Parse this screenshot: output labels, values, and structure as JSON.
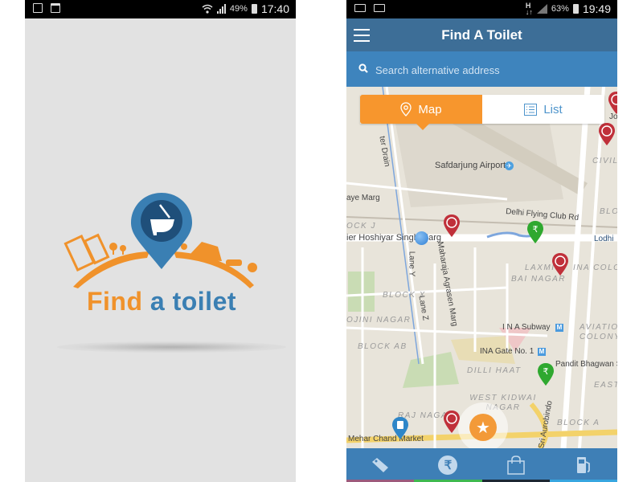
{
  "splash": {
    "status": {
      "battery": "49%",
      "time": "17:40",
      "left_icons": [
        "gallery-icon",
        "clipboard-check-icon"
      ],
      "right_icons": [
        "wifi-icon",
        "signal-icon",
        "battery-icon"
      ]
    },
    "logo": {
      "word1": "Find",
      "word2": "a toilet",
      "colors": {
        "orange": "#f0922b",
        "blue": "#3a7fb3",
        "dark_blue": "#1f4f7a"
      }
    }
  },
  "app": {
    "status": {
      "battery": "63%",
      "time": "19:49",
      "left_icons": [
        "settings-mail-icon",
        "mail-icon"
      ],
      "right_icons": [
        "h-plus-data-icon",
        "signal-icon",
        "battery-icon"
      ]
    },
    "appbar": {
      "title": "Find A Toilet",
      "menu_icon": "hamburger-icon",
      "color": "#3d6e97"
    },
    "search": {
      "placeholder": "Search alternative address",
      "value": "",
      "icon": "search-icon",
      "color": "#3e84bd"
    },
    "toggle": {
      "map_label": "Map",
      "list_label": "List",
      "active": "Map",
      "active_color": "#f7962d"
    },
    "map": {
      "labels": [
        {
          "text": "Safdarjung Airport",
          "type": "poi"
        },
        {
          "text": "Delhi Flying Club Rd",
          "type": "road"
        },
        {
          "text": "aye Marg",
          "type": "road"
        },
        {
          "text": "ier Hoshiyar Singh Marg",
          "type": "road"
        },
        {
          "text": "Lodhi",
          "type": "road"
        },
        {
          "text": "Lane Y",
          "type": "road"
        },
        {
          "text": "Lane Z",
          "type": "road"
        },
        {
          "text": "Maharaja Agrasen Marg",
          "type": "road"
        },
        {
          "text": "ter Drain",
          "type": "road"
        },
        {
          "text": "OCK J",
          "type": "area"
        },
        {
          "text": "LAXMI",
          "type": "area"
        },
        {
          "text": "INA COLO",
          "type": "area"
        },
        {
          "text": "BAI NAGAR",
          "type": "area"
        },
        {
          "text": "BLOCK X",
          "type": "area"
        },
        {
          "text": "OJINI NAGAR",
          "type": "area"
        },
        {
          "text": "BLOCK AB",
          "type": "area"
        },
        {
          "text": "I N A Subway",
          "type": "poi"
        },
        {
          "text": "INA Gate No. 1",
          "type": "poi"
        },
        {
          "text": "AVIATION COLONY",
          "type": "area"
        },
        {
          "text": "DILLI HAAT",
          "type": "area"
        },
        {
          "text": "Pandit Bhagwan S",
          "type": "road"
        },
        {
          "text": "EAST",
          "type": "area"
        },
        {
          "text": "WEST KIDWAI NAGAR",
          "type": "area"
        },
        {
          "text": "RAJ NAGAR",
          "type": "area"
        },
        {
          "text": "BLOCK A",
          "type": "area"
        },
        {
          "text": "Sri Aurobindo",
          "type": "road"
        },
        {
          "text": "Mehar Chand Market",
          "type": "poi"
        },
        {
          "text": "CIVIL",
          "type": "area"
        },
        {
          "text": "BLO",
          "type": "area"
        },
        {
          "text": "Jo",
          "type": "road"
        }
      ],
      "markers": [
        {
          "kind": "free-toilet",
          "color": "#c0303a"
        },
        {
          "kind": "paid-toilet",
          "color": "#2fa82f"
        },
        {
          "kind": "free-toilet",
          "color": "#c0303a"
        },
        {
          "kind": "paid-toilet",
          "color": "#2fa82f"
        },
        {
          "kind": "free-toilet",
          "color": "#c0303a"
        },
        {
          "kind": "free-toilet",
          "color": "#c0303a"
        },
        {
          "kind": "free-toilet",
          "color": "#c0303a"
        },
        {
          "kind": "fuel-station",
          "color": "#2e86c8"
        },
        {
          "kind": "current-location",
          "color": "#3a8ee0"
        }
      ],
      "fab_icon": "star-icon"
    },
    "bottom_nav": [
      {
        "name": "free",
        "icon": "free-tag-icon",
        "bar_color": "#9c5a7c"
      },
      {
        "name": "paid",
        "icon": "rupee-icon",
        "bar_color": "#3fb950"
      },
      {
        "name": "shopping",
        "icon": "shopping-bag-icon",
        "bar_color": "#1c2733"
      },
      {
        "name": "fuel",
        "icon": "fuel-pump-icon",
        "bar_color": "#37a6e0"
      }
    ]
  }
}
